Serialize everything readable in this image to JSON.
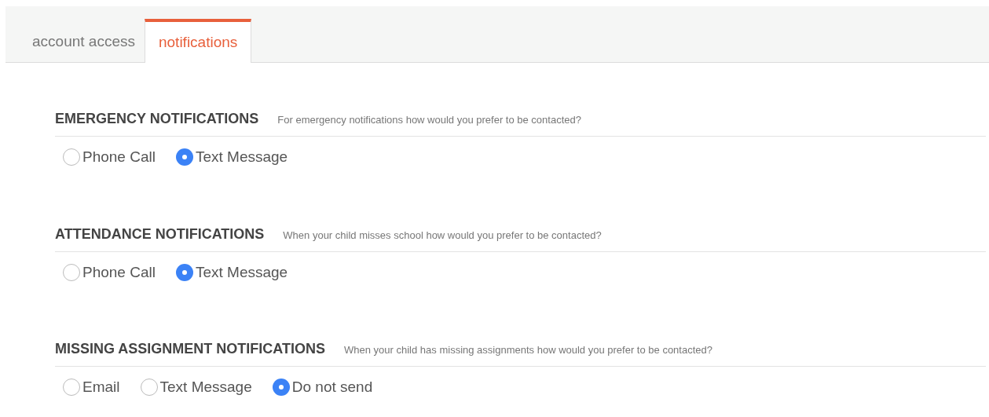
{
  "tabs": [
    {
      "label": "account access",
      "selected": false
    },
    {
      "label": "notifications",
      "selected": true
    }
  ],
  "sections": [
    {
      "title": "EMERGENCY NOTIFICATIONS",
      "prompt": "For emergency notifications how would you prefer to be contacted?",
      "options": [
        {
          "label": "Phone Call",
          "selected": false
        },
        {
          "label": "Text Message",
          "selected": true
        }
      ]
    },
    {
      "title": "ATTENDANCE NOTIFICATIONS",
      "prompt": "When your child misses school how would you prefer to be contacted?",
      "options": [
        {
          "label": "Phone Call",
          "selected": false
        },
        {
          "label": "Text Message",
          "selected": true
        }
      ]
    },
    {
      "title": "MISSING ASSIGNMENT NOTIFICATIONS",
      "prompt": "When your child has missing assignments how would you prefer to be contacted?",
      "options": [
        {
          "label": "Email",
          "selected": false
        },
        {
          "label": "Text Message",
          "selected": false
        },
        {
          "label": "Do not send",
          "selected": true
        }
      ]
    }
  ]
}
